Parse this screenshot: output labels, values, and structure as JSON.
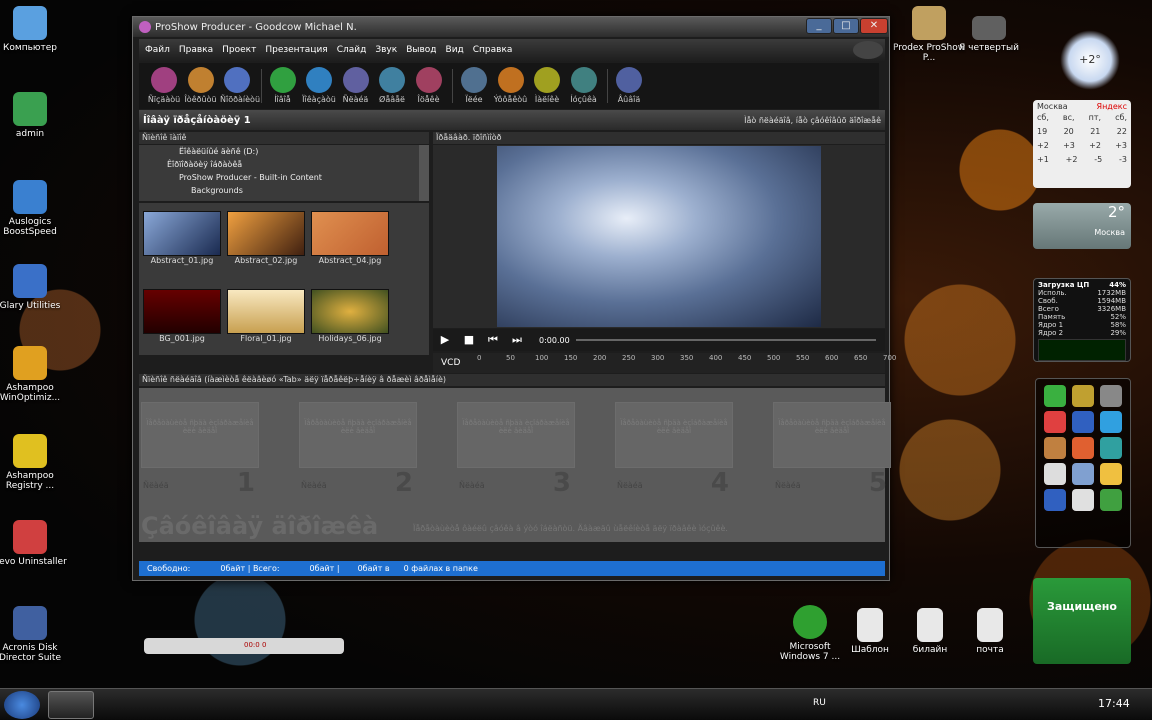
{
  "desktop_icons": [
    {
      "label": "Компьютер",
      "color": "#5aa0e0"
    },
    {
      "label": "admin",
      "color": "#3aa050"
    },
    {
      "label": "Auslogics BoostSpeed",
      "color": "#3a80d0"
    },
    {
      "label": "Glary Utilities",
      "color": "#3a70c8"
    },
    {
      "label": "Ashampoo WinOptimiz...",
      "color": "#e0a020"
    },
    {
      "label": "Ashampoo Registry ...",
      "color": "#e0c020"
    },
    {
      "label": "Revo Uninstaller",
      "color": "#d04040"
    },
    {
      "label": "Acronis Disk Director Suite",
      "color": "#4060a0"
    }
  ],
  "right_icons": [
    {
      "label": "Prodex ProShow P...",
      "color": "#c0a060"
    },
    {
      "label": "Я четвертый",
      "color": "#606060"
    }
  ],
  "bottom_icons": [
    {
      "label": "Microsoft Windows 7 ...",
      "color": "#2fa030"
    },
    {
      "label": "Шаблон",
      "color": "#e8e8e8"
    },
    {
      "label": "билайн",
      "color": "#e8e8e8"
    },
    {
      "label": "почта",
      "color": "#e8e8e8"
    }
  ],
  "window": {
    "title": "ProShow Producer - Goodcow Michael N.",
    "menu": [
      "Файл",
      "Правка",
      "Проект",
      "Презентация",
      "Слайд",
      "Звук",
      "Вывод",
      "Вид",
      "Справка"
    ],
    "toolbar": [
      "Ñïçäàòü",
      "Îòêðûòü",
      "Ñîõðàíèòü",
      "Íîâîå",
      "Ïîêàçàòü",
      "Ñëàéä",
      "Øåâåë",
      "Îöåêè",
      "Ïëée",
      "Ýôôåêòû",
      "Ìàëíêè",
      "Íóçûêà",
      "Âûâîä"
    ],
    "project_title": "Íîâàÿ ïðåçåíòàöèÿ 1",
    "project_hint": "Ìåò ñëàéäîâ, íåò çâóêîâûõ äîðîæåê",
    "folder_panel_title": "Ñïèñîê ïàïîê",
    "tree": [
      "Ëîêàëüíûé äèñê (D:)",
      "Êîðïîðàöèÿ îáðàòêå",
      "ProShow Producer - Built-in Content",
      "Backgrounds"
    ],
    "thumbnails": [
      "Abstract_01.jpg",
      "Abstract_02.jpg",
      "Abstract_04.jpg",
      "BG_001.jpg",
      "Floral_01.jpg",
      "Holidays_06.jpg"
    ],
    "preview_title": "Ïðåäâàð. ïðîñìîòð",
    "timecode": "0:00.00",
    "vcd_label": "VCD",
    "ruler": [
      "0",
      "50",
      "100",
      "150",
      "200",
      "250",
      "300",
      "350",
      "400",
      "450",
      "500",
      "550",
      "600",
      "650",
      "700"
    ],
    "storyboard_hint": "Ñïèñîê ñëàéäîâ (íàæìèòå êëàâèøó «Tab» äëÿ ïåðåêëþ÷åíèÿ â ðåæèì âðåìåíè)",
    "slide_placeholder": "Ïåðåòàùèòå ñþäà èçîáðàæåíèå èëè âèäåî",
    "slide_label": "Ñëàéä",
    "slide_numbers": [
      "1",
      "2",
      "3",
      "4",
      "5"
    ],
    "soundtrack_title": "Çâóêîâàÿ äîðîæêà",
    "soundtrack_hint": "Ïåðåòàùèòå ôàéëû çâóêà â ýòó îáëàñòü. Äâàæäû ùåëêíèòå äëÿ ïðàâêè ìóçûêè.",
    "status": {
      "free": "Свободно:",
      "sel": "0байт | Всего:",
      "total": "0байт |",
      "sel2": "0байт в",
      "files": "0 файлах в папке"
    }
  },
  "widgets": {
    "weather_city": "Москва",
    "weather_brand": "Яндекс",
    "days": [
      "сб,",
      "вс,",
      "пт,",
      "сб,"
    ],
    "dates": [
      "19",
      "20",
      "21",
      "22"
    ],
    "temps1": [
      "+2",
      "+3",
      "+2",
      "+3"
    ],
    "temps2": [
      "+1",
      "+2",
      "-5",
      "-3"
    ],
    "balloon_temp": "+2°",
    "weather2_temp": "2°",
    "weather2_city": "Москва",
    "cpu_title": "Загрузка ЦП",
    "cpu_pct": "44%",
    "cpu_labels": [
      "Исполь.",
      "Своб.",
      "Всего"
    ],
    "cpu_vals": [
      "1732MB",
      "1594MB",
      "3326MB"
    ],
    "mem_labels": [
      "Память",
      "Ядро 1",
      "Ядро 2"
    ],
    "mem_vals": [
      "52%",
      "58%",
      "29%"
    ],
    "protect_label": "Защищено"
  },
  "media_player": {
    "time": "00:0 0"
  },
  "taskbar": {
    "lang": "RU",
    "time": "17:44"
  }
}
